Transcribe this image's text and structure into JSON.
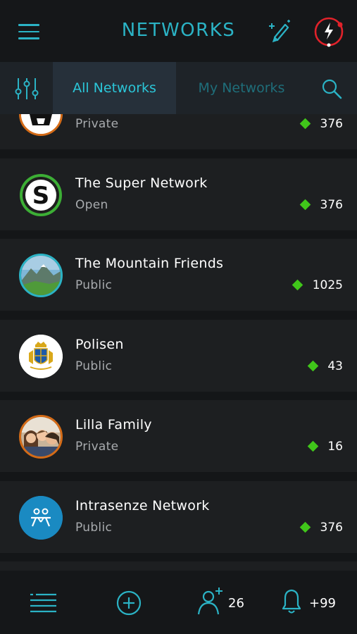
{
  "header": {
    "title": "NETWORKS",
    "accent": "#2bb3c5",
    "menu_icon": "hamburger-menu-icon",
    "edit_icon": "magic-pen-icon",
    "power_icon": "power-lightning-icon"
  },
  "tabs": {
    "filter_icon": "sliders-icon",
    "all_label": "All Networks",
    "my_label": "My Networks",
    "search_icon": "search-icon",
    "active": "All Networks"
  },
  "networks": [
    {
      "name": "",
      "type": "Private",
      "count": "376",
      "avatar": "partial-black-white-logo"
    },
    {
      "name": "The Super Network",
      "type": "Open",
      "count": "376",
      "avatar": "super-s-logo"
    },
    {
      "name": "The Mountain Friends",
      "type": "Public",
      "count": "1025",
      "avatar": "mountain-landscape-photo"
    },
    {
      "name": "Polisen",
      "type": "Public",
      "count": "43",
      "avatar": "police-crest"
    },
    {
      "name": "Lilla Family",
      "type": "Private",
      "count": "16",
      "avatar": "family-photo"
    },
    {
      "name": "Intrasenze Network",
      "type": "Public",
      "count": "376",
      "avatar": "intrasenze-logo"
    }
  ],
  "status_color": "#40c61a",
  "footer": {
    "list_icon": "list-icon",
    "add_icon": "add-circle-icon",
    "contacts_icon": "add-contact-icon",
    "contacts_count": "26",
    "bell_icon": "bell-icon",
    "notifications_count": "+99"
  }
}
